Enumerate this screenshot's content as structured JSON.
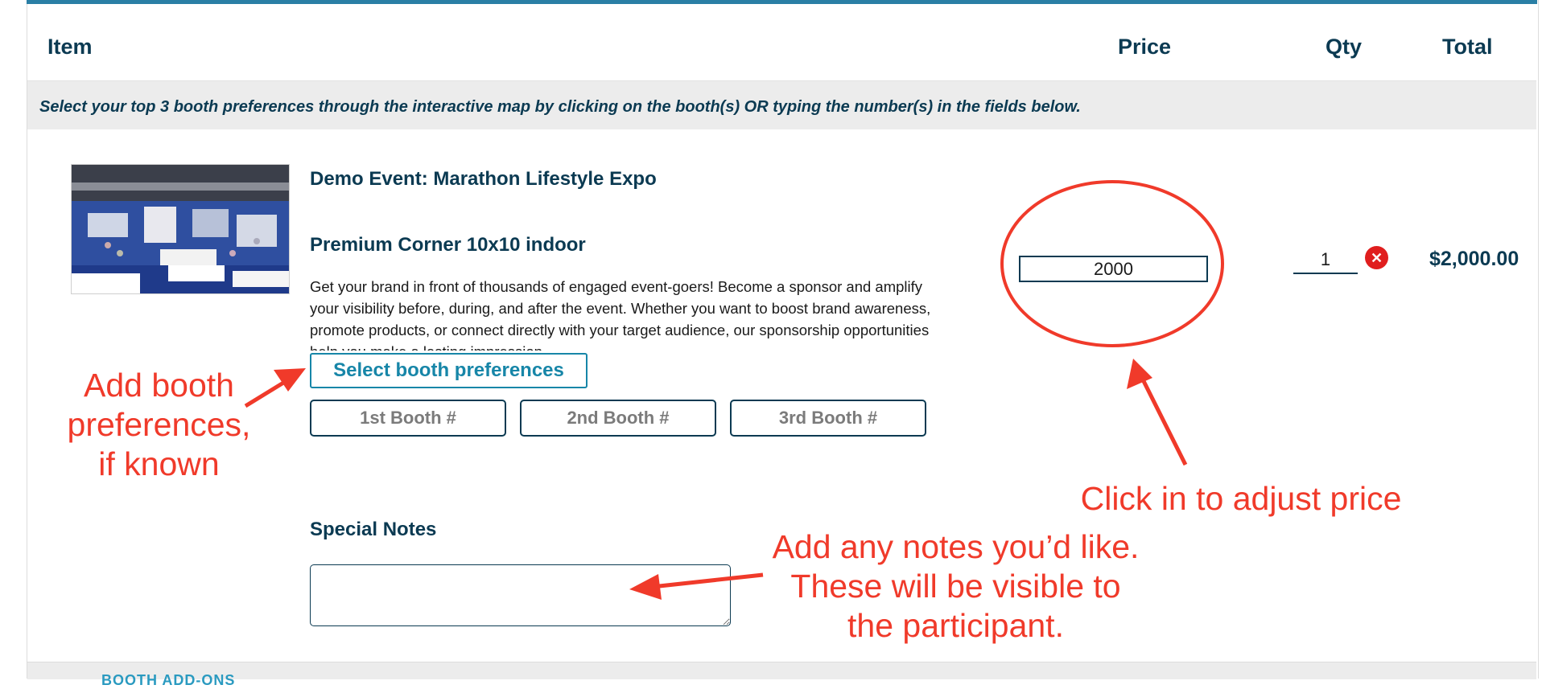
{
  "table": {
    "columns": {
      "item": "Item",
      "price": "Price",
      "qty": "Qty",
      "total": "Total"
    },
    "notice": "Select your top 3 booth preferences through the interactive map by clicking on the booth(s) OR typing the number(s) in the fields below."
  },
  "item": {
    "event_name": "Demo Event: Marathon Lifestyle Expo",
    "product_name": "Premium Corner 10x10 indoor",
    "description": "Get your brand in front of thousands of engaged event-goers! Become a sponsor and amplify your visibility before, during, and after the event. Whether you want to boost brand awareness, promote products, or connect directly with your target audience, our sponsorship opportunities help you make a lasting impression.",
    "thumbnail_icon": "expo-hall-photo",
    "select_booth_label": "Select booth preferences",
    "booth_fields": [
      {
        "placeholder": "1st Booth #"
      },
      {
        "placeholder": "2nd Booth #"
      },
      {
        "placeholder": "3rd Booth #"
      }
    ],
    "special_notes_label": "Special Notes",
    "special_notes_value": "",
    "price_value": "2000",
    "qty_value": "1",
    "remove_icon": "close-icon",
    "total": "$2,000.00"
  },
  "annotations": {
    "booth": "Add booth preferences, if known",
    "price": "Click in to adjust price",
    "notes": "Add any notes you’d like. These will be visible to the participant.",
    "color": "#f03a2a"
  },
  "footer": {
    "section_label": "BOOTH ADD-ONS"
  },
  "colors": {
    "accent": "#1786a8",
    "text": "#0b3a52",
    "remove": "#e01e1e"
  }
}
